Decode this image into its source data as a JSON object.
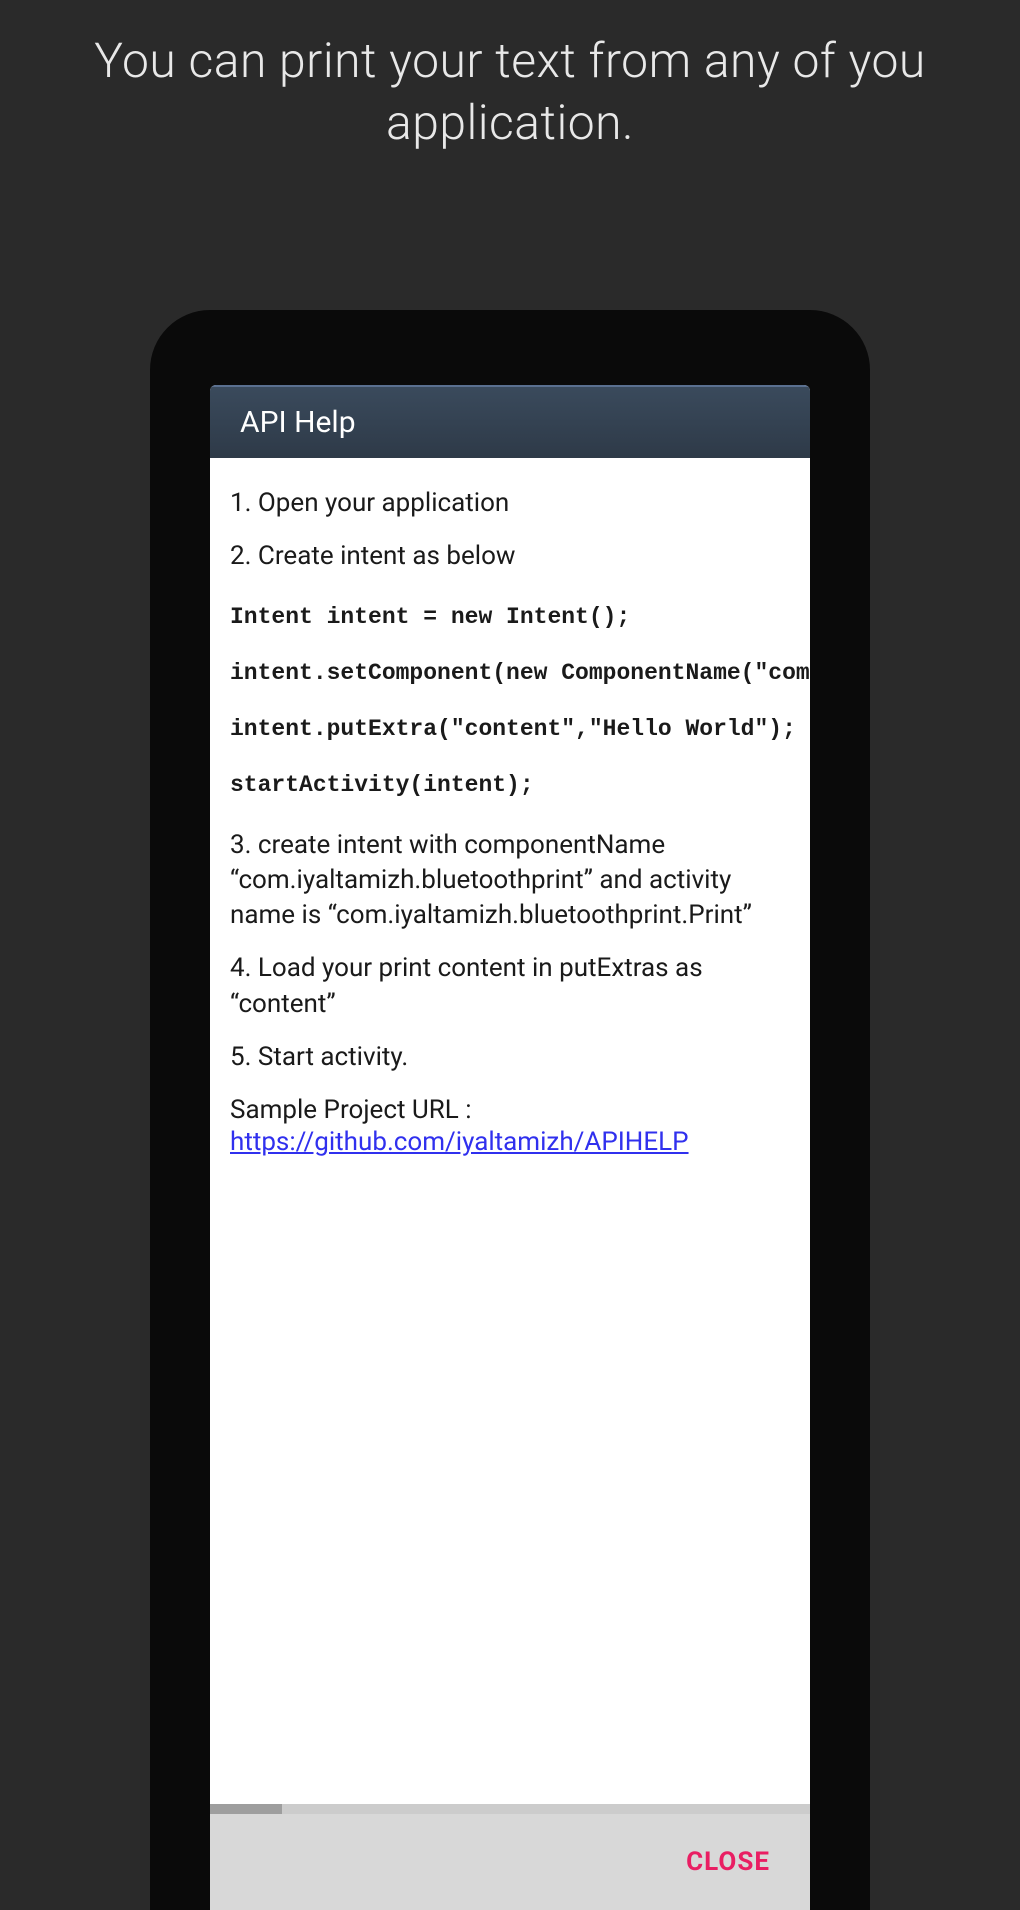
{
  "promo": {
    "text": "You can print your text from any of you application."
  },
  "dialog": {
    "title": "API Help",
    "steps": {
      "step1": "1. Open your application",
      "step2": "2. Create intent as below",
      "code1": "Intent intent = new Intent();",
      "code2": "intent.setComponent(new ComponentName(\"com.",
      "code3": "intent.putExtra(\"content\",\"Hello World\");",
      "code4": "startActivity(intent);",
      "step3": "3. create intent with componentName “com.iyaltamizh.bluetoothprint” and activity name is “com.iyaltamizh.bluetoothprint.Print”",
      "step4": "4. Load your print content in putExtras as “content”",
      "step5": "5. Start activity.",
      "sample_label": "Sample Project URL :",
      "sample_url": "https://github.com/iyaltamizh/APIHELP"
    },
    "close_label": "CLOSE"
  }
}
